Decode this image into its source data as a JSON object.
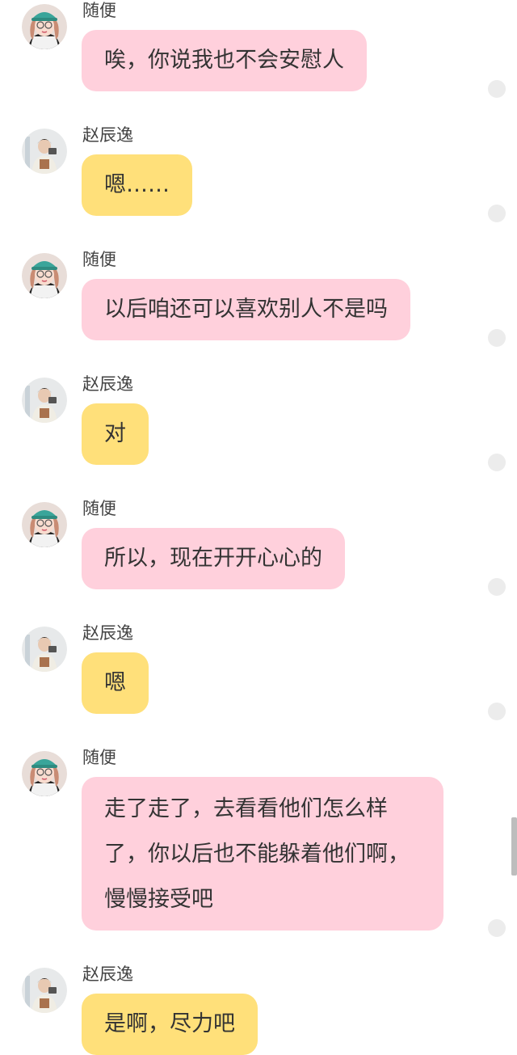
{
  "messages": [
    {
      "sender": "随便",
      "text": "唉，你说我也不会安慰人",
      "side": "girl"
    },
    {
      "sender": "赵辰逸",
      "text": "嗯……",
      "side": "boy"
    },
    {
      "sender": "随便",
      "text": "以后咱还可以喜欢别人不是吗",
      "side": "girl"
    },
    {
      "sender": "赵辰逸",
      "text": "对",
      "side": "boy"
    },
    {
      "sender": "随便",
      "text": "所以，现在开开心心的",
      "side": "girl"
    },
    {
      "sender": "赵辰逸",
      "text": "嗯",
      "side": "boy"
    },
    {
      "sender": "随便",
      "text": "走了走了，去看看他们怎么样了，你以后也不能躲着他们啊，慢慢接受吧",
      "side": "girl"
    },
    {
      "sender": "赵辰逸",
      "text": "是啊，尽力吧",
      "side": "boy"
    }
  ],
  "colors": {
    "girl_bubble": "#ffd0dc",
    "boy_bubble": "#ffe07a"
  },
  "icons": {
    "girl_avatar": "girl-with-teal-cap-avatar",
    "boy_avatar": "boy-photo-avatar",
    "status": "read-status-dot"
  }
}
